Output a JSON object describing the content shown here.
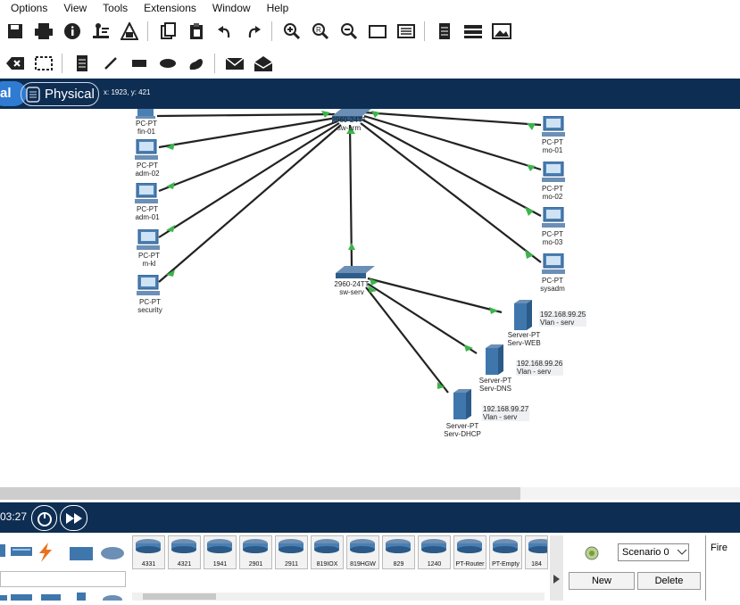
{
  "menu": [
    "Options",
    "View",
    "Tools",
    "Extensions",
    "Window",
    "Help"
  ],
  "toolbar1_icons": [
    "save-icon",
    "print-icon",
    "info-icon",
    "network-wizard-icon",
    "pdu-icon",
    "copy-icon",
    "paste-icon",
    "undo-icon",
    "redo-icon",
    "zoom-in-icon",
    "zoom-reset-icon",
    "zoom-out-icon",
    "drawing-palette-icon",
    "custom-device-icon",
    "text-file-icon",
    "cluster-icon",
    "image-icon"
  ],
  "toolbar2_icons": [
    "delete-icon",
    "resize-icon",
    "note-icon",
    "line-icon",
    "rectangle-icon",
    "ellipse-icon",
    "freeform-icon",
    "mail-icon",
    "open-mail-icon"
  ],
  "tabs": {
    "logical": "al",
    "physical": "Physical"
  },
  "coords": "x: 1923, y: 421",
  "devices": {
    "pc_fin01": {
      "type": "PC-PT",
      "name": "fin-01"
    },
    "pc_adm02": {
      "type": "PC-PT",
      "name": "adm-02"
    },
    "pc_adm01": {
      "type": "PC-PT",
      "name": "adm-01"
    },
    "pc_mkl": {
      "type": "PC-PT",
      "name": "m-kl"
    },
    "pc_security": {
      "type": "PC-PT",
      "name": "security"
    },
    "pc_mo01": {
      "type": "PC-PT",
      "name": "mo-01"
    },
    "pc_mo02": {
      "type": "PC-PT",
      "name": "mo-02"
    },
    "pc_mo03": {
      "type": "PC-PT",
      "name": "mo-03"
    },
    "pc_sysadm": {
      "type": "PC-PT",
      "name": "sysadm"
    },
    "sw_arm": {
      "type": "2960-24TT",
      "name": "sw-arm"
    },
    "sw_serv": {
      "type": "2960-24TT",
      "name": "sw-serv"
    },
    "srv_web": {
      "type": "Server-PT",
      "name": "Serv-WEB",
      "ip": "192.168.99.25",
      "vlan": "Vlan - serv"
    },
    "srv_dns": {
      "type": "Server-PT",
      "name": "Serv-DNS",
      "ip": "192.168.99.26",
      "vlan": "Vlan - serv"
    },
    "srv_dhcp": {
      "type": "Server-PT",
      "name": "Serv-DHCP",
      "ip": "192.168.99.27",
      "vlan": "Vlan - serv"
    }
  },
  "timer": "03:27",
  "device_models": [
    "4331",
    "4321",
    "1941",
    "2901",
    "2911",
    "819IOX",
    "819HGW",
    "829",
    "1240",
    "PT-Router",
    "PT-Empty",
    "184"
  ],
  "scenario": {
    "selected": "Scenario 0",
    "new_label": "New",
    "delete_label": "Delete",
    "fire_label": "Fire"
  },
  "colors": {
    "topbar": "#0e2d52",
    "logical_tab": "#2f7bd1",
    "link_dot": "#3cb44b"
  }
}
